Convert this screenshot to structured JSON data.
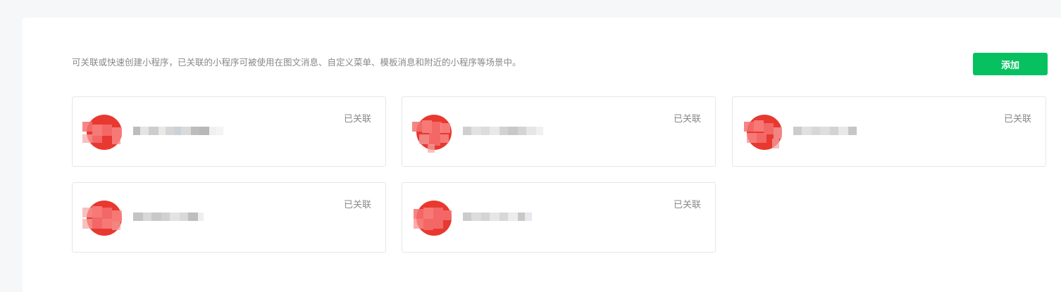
{
  "description": "可关联或快速创建小程序，已关联的小程序可被使用在图文消息、自定义菜单、模板消息和附近的小程序等场景中。",
  "add_button_label": "添加",
  "colors": {
    "primary": "#07c160",
    "avatar": "#e8382f",
    "muted_text": "#888888",
    "border": "#e4e6ea"
  },
  "cards": [
    {
      "status": "已关联"
    },
    {
      "status": "已关联"
    },
    {
      "status": "已关联"
    },
    {
      "status": "已关联"
    },
    {
      "status": "已关联"
    }
  ]
}
